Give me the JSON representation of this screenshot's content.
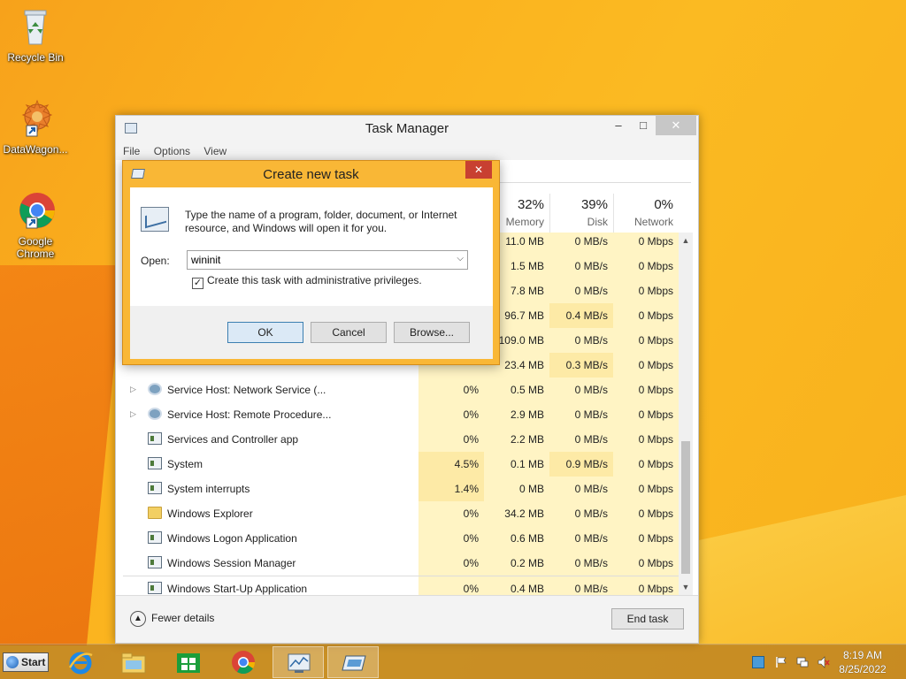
{
  "desktop": {
    "icons": [
      {
        "label": "Recycle Bin"
      },
      {
        "label": "DataWagon..."
      },
      {
        "label": "Google Chrome"
      }
    ]
  },
  "taskmanager": {
    "title": "Task Manager",
    "menu": [
      "File",
      "Options",
      "View"
    ],
    "columns": {
      "memory": {
        "pct": "32%",
        "name": "Memory"
      },
      "disk": {
        "pct": "39%",
        "name": "Disk"
      },
      "network": {
        "pct": "0%",
        "name": "Network"
      }
    },
    "rows": [
      {
        "name": "",
        "cpu": "",
        "mem": "11.0 MB",
        "disk": "0 MB/s",
        "net": "0 Mbps",
        "icon": "proc-icon",
        "expand": false
      },
      {
        "name": "",
        "cpu": "",
        "mem": "1.5 MB",
        "disk": "0 MB/s",
        "net": "0 Mbps",
        "icon": "proc-icon",
        "expand": false
      },
      {
        "name": "",
        "cpu": "",
        "mem": "7.8 MB",
        "disk": "0 MB/s",
        "net": "0 Mbps",
        "icon": "proc-icon",
        "expand": false
      },
      {
        "name": "",
        "cpu": "",
        "mem": "96.7 MB",
        "disk": "0.4 MB/s",
        "net": "0 Mbps",
        "icon": "proc-icon",
        "expand": false
      },
      {
        "name": "",
        "cpu": "",
        "mem": "109.0 MB",
        "disk": "0 MB/s",
        "net": "0 Mbps",
        "icon": "proc-icon",
        "expand": false
      },
      {
        "name": "",
        "cpu": "",
        "mem": "23.4 MB",
        "disk": "0.3 MB/s",
        "net": "0 Mbps",
        "icon": "proc-icon",
        "expand": false
      },
      {
        "name": "Service Host: Network Service (...",
        "cpu": "0%",
        "mem": "0.5 MB",
        "disk": "0 MB/s",
        "net": "0 Mbps",
        "icon": "gear-icon",
        "expand": true
      },
      {
        "name": "Service Host: Remote Procedure...",
        "cpu": "0%",
        "mem": "2.9 MB",
        "disk": "0 MB/s",
        "net": "0 Mbps",
        "icon": "gear-icon",
        "expand": true
      },
      {
        "name": "Services and Controller app",
        "cpu": "0%",
        "mem": "2.2 MB",
        "disk": "0 MB/s",
        "net": "0 Mbps",
        "icon": "proc-icon",
        "expand": false
      },
      {
        "name": "System",
        "cpu": "4.5%",
        "mem": "0.1 MB",
        "disk": "0.9 MB/s",
        "net": "0 Mbps",
        "icon": "proc-icon",
        "expand": false
      },
      {
        "name": "System interrupts",
        "cpu": "1.4%",
        "mem": "0 MB",
        "disk": "0 MB/s",
        "net": "0 Mbps",
        "icon": "proc-icon",
        "expand": false
      },
      {
        "name": "Windows Explorer",
        "cpu": "0%",
        "mem": "34.2 MB",
        "disk": "0 MB/s",
        "net": "0 Mbps",
        "icon": "folder-icon",
        "expand": false
      },
      {
        "name": "Windows Logon Application",
        "cpu": "0%",
        "mem": "0.6 MB",
        "disk": "0 MB/s",
        "net": "0 Mbps",
        "icon": "proc-icon",
        "expand": false
      },
      {
        "name": "Windows Session Manager",
        "cpu": "0%",
        "mem": "0.2 MB",
        "disk": "0 MB/s",
        "net": "0 Mbps",
        "icon": "proc-icon",
        "expand": false
      },
      {
        "name": "Windows Start-Up Application",
        "cpu": "0%",
        "mem": "0.4 MB",
        "disk": "0 MB/s",
        "net": "0 Mbps",
        "icon": "proc-icon",
        "expand": false
      }
    ],
    "fewer_details": "Fewer details",
    "end_task": "End task"
  },
  "dialog": {
    "title": "Create new task",
    "close": "✕",
    "description": "Type the name of a program, folder, document, or Internet resource, and Windows will open it for you.",
    "open_label": "Open:",
    "open_value": "wininit",
    "admin_checkbox_label": "Create this task with administrative privileges.",
    "admin_checked": true,
    "ok": "OK",
    "cancel": "Cancel",
    "browse": "Browse..."
  },
  "taskbar": {
    "start_label": "Start",
    "apps": [
      "internet-explorer-icon",
      "file-explorer-icon",
      "store-icon",
      "chrome-icon",
      "task-manager-icon",
      "run-dialog-icon"
    ],
    "time": "8:19 AM",
    "date": "8/25/2022"
  },
  "colors": {
    "desktop": "#fbb21e",
    "dialog_frame": "#f9b736",
    "close_red": "#c84031",
    "cell_highlight": "#fff4c4"
  }
}
